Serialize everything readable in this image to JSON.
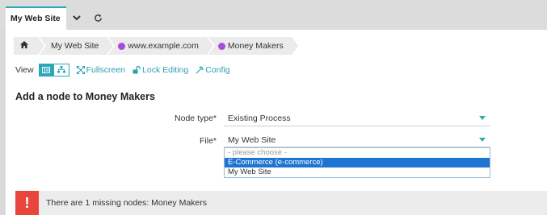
{
  "tabs": {
    "active_label": "My Web Site",
    "dropdown_icon": "chevron-down-icon",
    "refresh_icon": "refresh-icon"
  },
  "breadcrumb": {
    "home_icon": "home-icon",
    "items": [
      {
        "label": "My Web Site",
        "dot_color": null
      },
      {
        "label": "www.example.com",
        "dot_color": "#a64dd9"
      },
      {
        "label": "Money Makers",
        "dot_color": "#a64dd9"
      }
    ]
  },
  "view": {
    "label": "View",
    "fullscreen_label": "Fullscreen",
    "lock_label": "Lock Editing",
    "config_label": "Config"
  },
  "form": {
    "title": "Add a node to Money Makers",
    "node_type_label": "Node type*",
    "node_type_value": "Existing Process",
    "file_label": "File*",
    "file_value": "My Web Site",
    "options": [
      "- please choose -",
      "E-Commerce (e-commerce)",
      "My Web Site"
    ],
    "highlighted_option_index": 1
  },
  "alert": {
    "icon": "exclamation-icon",
    "text": "There are 1 missing nodes: Money Makers"
  },
  "colors": {
    "accent": "#2aa7b8",
    "purple": "#a64dd9",
    "alert": "#e8453c",
    "selection": "#1e74d0"
  }
}
